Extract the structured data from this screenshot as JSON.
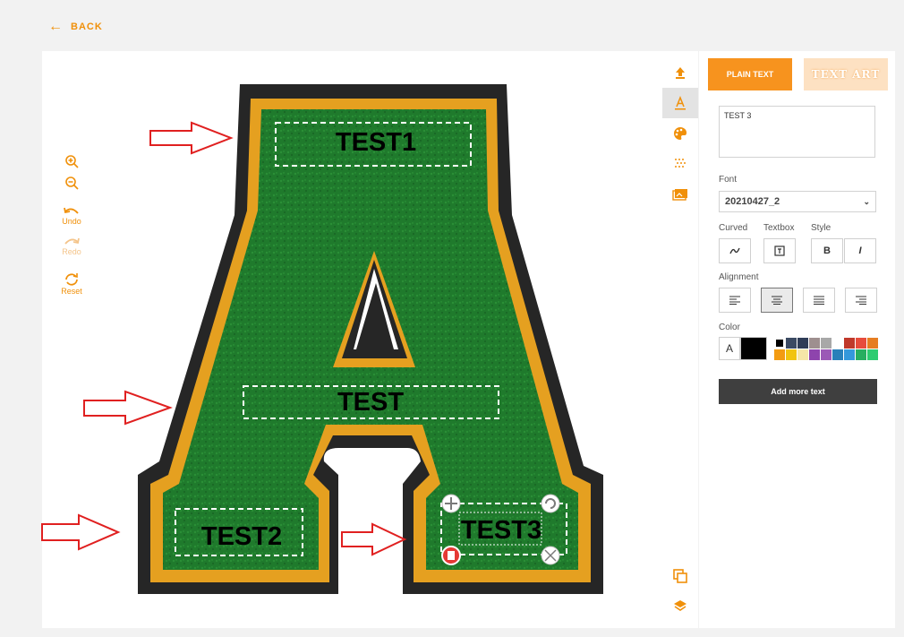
{
  "nav": {
    "back_label": "BACK"
  },
  "left_tools": [
    {
      "name": "zoom-in",
      "label": ""
    },
    {
      "name": "zoom-out",
      "label": ""
    },
    {
      "name": "undo",
      "label": "Undo"
    },
    {
      "name": "redo",
      "label": "Redo"
    },
    {
      "name": "reset",
      "label": "Reset"
    }
  ],
  "right_tools": [
    "upload-icon",
    "text-icon",
    "palette-icon",
    "pattern-icon",
    "image-icon",
    "duplicate-icon",
    "layers-icon"
  ],
  "canvas": {
    "texts": [
      {
        "id": "test1",
        "value": "TEST1"
      },
      {
        "id": "test",
        "value": "TEST"
      },
      {
        "id": "test2",
        "value": "TEST2"
      },
      {
        "id": "test3",
        "value": "TEST3",
        "selected": true
      }
    ]
  },
  "sidebar": {
    "tabs": {
      "plain": "PLAIN TEXT",
      "art": "TEXT ART"
    },
    "text_value": "TEST 3",
    "font_label": "Font",
    "font_value": "20210427_2",
    "curved_label": "Curved",
    "textbox_label": "Textbox",
    "style_label": "Style",
    "bold_label": "B",
    "italic_label": "I",
    "alignment_label": "Alignment",
    "color_label": "Color",
    "color_a": "A",
    "add_more_label": "Add more text",
    "colors": [
      "#000000",
      "#3b4a63",
      "#2f3d57",
      "#9e8f8f",
      "#a8a8a8",
      "#ffffff",
      "#c0392b",
      "#e74c3c",
      "#e67e22",
      "#f39c12",
      "#f1c40f",
      "#f5e6a8",
      "#8e44ad",
      "#9b59b6",
      "#2980b9",
      "#3498db",
      "#27ae60",
      "#2ecc71"
    ]
  },
  "accent_color": "#f0900a"
}
